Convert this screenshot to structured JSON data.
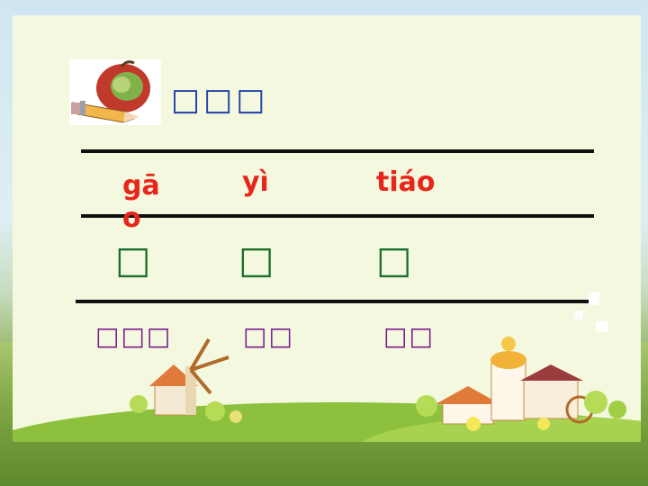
{
  "title": "□□□",
  "pinyin": [
    "gāo",
    "yì",
    "tiáo"
  ],
  "characters": [
    "□",
    "□",
    "□"
  ],
  "words": [
    "□□□",
    "□□",
    "□□"
  ],
  "colors": {
    "title": "#1f3fa6",
    "pinyin": "#e8251a",
    "characters": "#1b6f2a",
    "words": "#7a1e8a"
  },
  "icons": [
    "apple-pencil-icon",
    "windmill-house-icon",
    "farmhouse-icon"
  ]
}
